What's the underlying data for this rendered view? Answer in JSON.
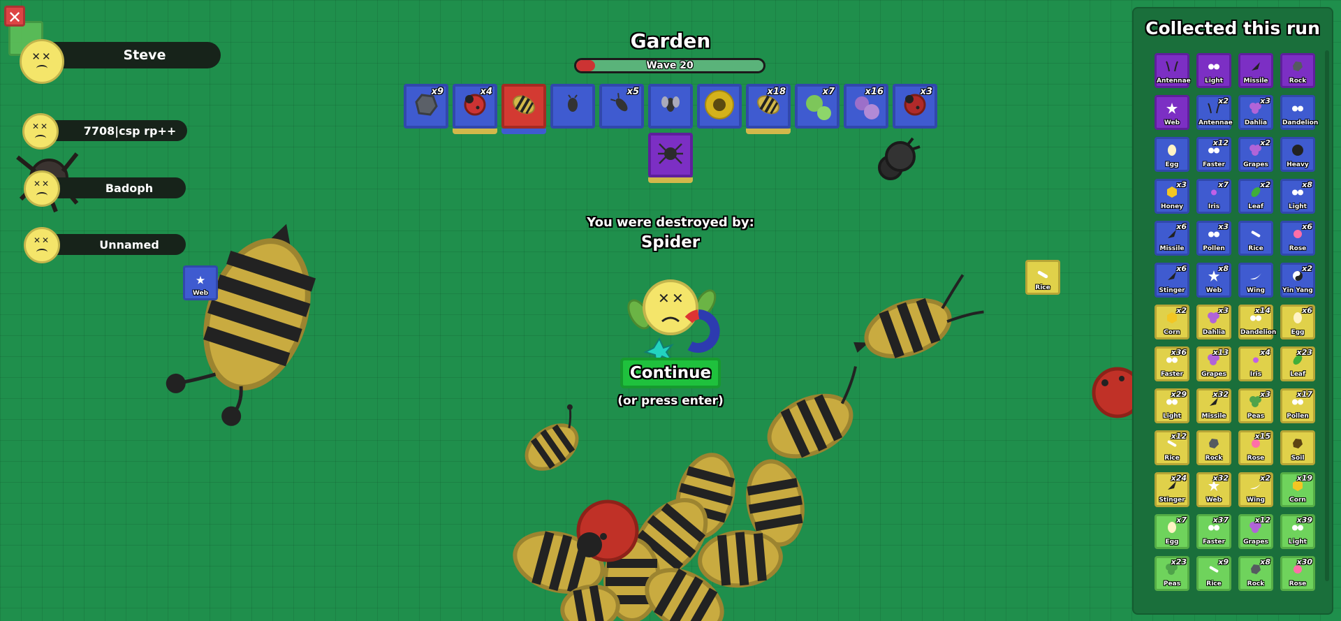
{
  "header": {
    "title": "Garden",
    "wave_label": "Wave 20",
    "wave_progress": 0.1
  },
  "players": [
    {
      "name": "Steve"
    },
    {
      "name": "7708|csp rp++"
    },
    {
      "name": "Badoph"
    },
    {
      "name": "Unnamed"
    }
  ],
  "close_label": "✕",
  "loadout": [
    {
      "count": "x9",
      "icon": "rock-icon",
      "color": "#5b6068",
      "under": ""
    },
    {
      "count": "x4",
      "icon": "ladybug-icon",
      "color": "#cc3333",
      "under": "#d2b84a"
    },
    {
      "count": "",
      "icon": "bee-icon",
      "color": "#d2b84a",
      "under": "#3f5bd0",
      "rarity_color": "#d33a32"
    },
    {
      "count": "",
      "icon": "beetle-icon",
      "color": "#333",
      "under": ""
    },
    {
      "count": "x5",
      "icon": "ant-icon",
      "color": "#333",
      "under": ""
    },
    {
      "count": "",
      "icon": "fly-icon",
      "color": "#333",
      "under": ""
    },
    {
      "count": "",
      "icon": "sunflower-icon",
      "color": "#d4b21c",
      "under": ""
    },
    {
      "count": "x18",
      "icon": "bee-icon",
      "color": "#d2b84a",
      "under": "#d2b84a"
    },
    {
      "count": "x7",
      "icon": "peas-icon",
      "color": "#7dc65a",
      "under": ""
    },
    {
      "count": "x16",
      "icon": "grapes-icon",
      "color": "#9c6fc9",
      "under": ""
    },
    {
      "count": "x3",
      "icon": "ladybug-icon",
      "color": "#b02a2a",
      "under": ""
    }
  ],
  "secondary_slot": {
    "icon": "spider-icon",
    "color": "#7c2fc4"
  },
  "death": {
    "destroyed_by": "You were destroyed by:",
    "killer": "Spider",
    "continue": "Continue",
    "hint": "(or press enter)"
  },
  "collected": {
    "title": "Collected this run",
    "rarity_colors": {
      "mythic": "#7c2fc4",
      "legendary": "#3f5bd0",
      "epic": "#e0d14a",
      "rare": "#6fd35c"
    },
    "items": [
      {
        "name": "Antennae",
        "count": "",
        "rarity": "mythic"
      },
      {
        "name": "Light",
        "count": "",
        "rarity": "mythic"
      },
      {
        "name": "Missile",
        "count": "",
        "rarity": "mythic"
      },
      {
        "name": "Rock",
        "count": "",
        "rarity": "mythic"
      },
      {
        "name": "Web",
        "count": "",
        "rarity": "mythic"
      },
      {
        "name": "Antennae",
        "count": "x2",
        "rarity": "legendary"
      },
      {
        "name": "Dahlia",
        "count": "x3",
        "rarity": "legendary"
      },
      {
        "name": "Dandelion",
        "count": "",
        "rarity": "legendary"
      },
      {
        "name": "Egg",
        "count": "",
        "rarity": "legendary"
      },
      {
        "name": "Faster",
        "count": "x12",
        "rarity": "legendary"
      },
      {
        "name": "Grapes",
        "count": "x2",
        "rarity": "legendary"
      },
      {
        "name": "Heavy",
        "count": "",
        "rarity": "legendary"
      },
      {
        "name": "Honey",
        "count": "x3",
        "rarity": "legendary"
      },
      {
        "name": "Iris",
        "count": "x7",
        "rarity": "legendary"
      },
      {
        "name": "Leaf",
        "count": "x2",
        "rarity": "legendary"
      },
      {
        "name": "Light",
        "count": "x8",
        "rarity": "legendary"
      },
      {
        "name": "Missile",
        "count": "x6",
        "rarity": "legendary"
      },
      {
        "name": "Pollen",
        "count": "x3",
        "rarity": "legendary"
      },
      {
        "name": "Rice",
        "count": "",
        "rarity": "legendary"
      },
      {
        "name": "Rose",
        "count": "x6",
        "rarity": "legendary"
      },
      {
        "name": "Stinger",
        "count": "x6",
        "rarity": "legendary"
      },
      {
        "name": "Web",
        "count": "x8",
        "rarity": "legendary"
      },
      {
        "name": "Wing",
        "count": "",
        "rarity": "legendary"
      },
      {
        "name": "Yin Yang",
        "count": "x2",
        "rarity": "legendary"
      },
      {
        "name": "Corn",
        "count": "x2",
        "rarity": "epic"
      },
      {
        "name": "Dahlia",
        "count": "x3",
        "rarity": "epic"
      },
      {
        "name": "Dandelion",
        "count": "x14",
        "rarity": "epic"
      },
      {
        "name": "Egg",
        "count": "x6",
        "rarity": "epic"
      },
      {
        "name": "Faster",
        "count": "x36",
        "rarity": "epic"
      },
      {
        "name": "Grapes",
        "count": "x13",
        "rarity": "epic"
      },
      {
        "name": "Iris",
        "count": "x4",
        "rarity": "epic"
      },
      {
        "name": "Leaf",
        "count": "x23",
        "rarity": "epic"
      },
      {
        "name": "Light",
        "count": "x29",
        "rarity": "epic"
      },
      {
        "name": "Missile",
        "count": "x32",
        "rarity": "epic"
      },
      {
        "name": "Peas",
        "count": "x3",
        "rarity": "epic"
      },
      {
        "name": "Pollen",
        "count": "x17",
        "rarity": "epic"
      },
      {
        "name": "Rice",
        "count": "x12",
        "rarity": "epic"
      },
      {
        "name": "Rock",
        "count": "",
        "rarity": "epic"
      },
      {
        "name": "Rose",
        "count": "x15",
        "rarity": "epic"
      },
      {
        "name": "Soil",
        "count": "",
        "rarity": "epic"
      },
      {
        "name": "Stinger",
        "count": "x24",
        "rarity": "epic"
      },
      {
        "name": "Web",
        "count": "x32",
        "rarity": "epic"
      },
      {
        "name": "Wing",
        "count": "x2",
        "rarity": "epic"
      },
      {
        "name": "Corn",
        "count": "x19",
        "rarity": "rare"
      },
      {
        "name": "Egg",
        "count": "x7",
        "rarity": "rare"
      },
      {
        "name": "Faster",
        "count": "x37",
        "rarity": "rare"
      },
      {
        "name": "Grapes",
        "count": "x12",
        "rarity": "rare"
      },
      {
        "name": "Light",
        "count": "x39",
        "rarity": "rare"
      },
      {
        "name": "Peas",
        "count": "x23",
        "rarity": "rare"
      },
      {
        "name": "Rice",
        "count": "x9",
        "rarity": "rare"
      },
      {
        "name": "Rock",
        "count": "x8",
        "rarity": "rare"
      },
      {
        "name": "Rose",
        "count": "x30",
        "rarity": "rare"
      }
    ]
  },
  "ground_drops": [
    {
      "name": "Web",
      "rarity": "legendary"
    },
    {
      "name": "Rice",
      "rarity": "epic"
    }
  ]
}
